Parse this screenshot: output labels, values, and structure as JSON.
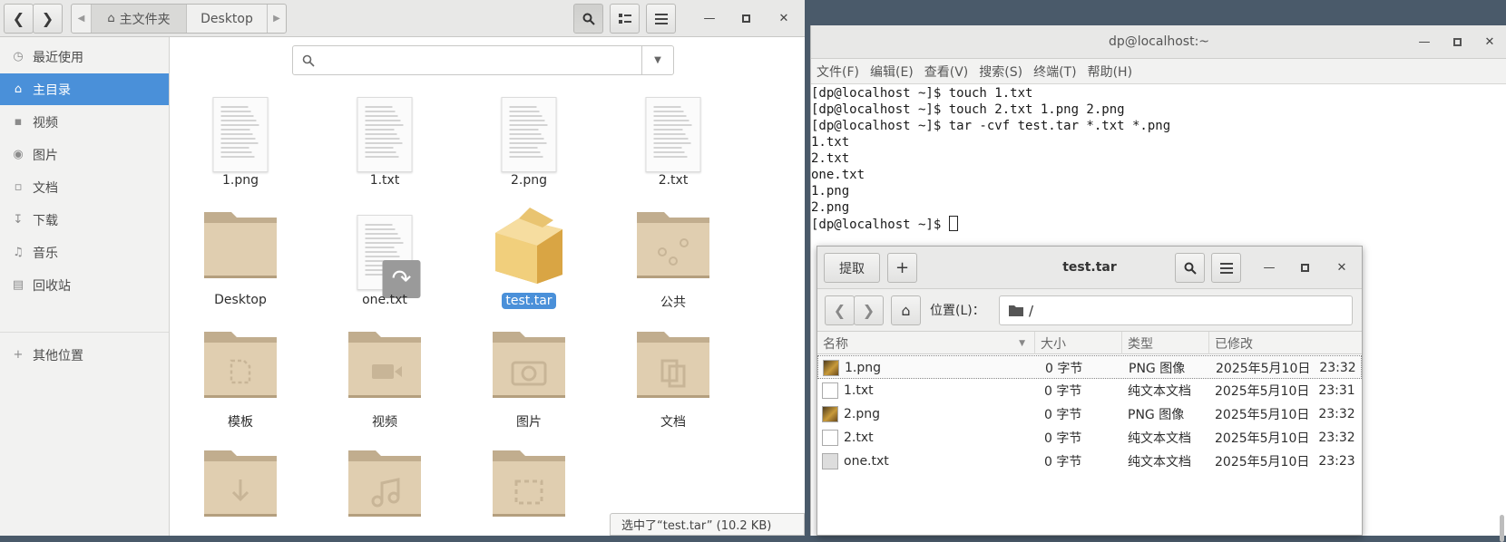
{
  "files": {
    "breadcrumb": {
      "home": "主文件夹",
      "current": "Desktop"
    },
    "sidebar": [
      {
        "label": "最近使用",
        "icon": "clock-icon"
      },
      {
        "label": "主目录",
        "icon": "home-icon",
        "active": true
      },
      {
        "label": "视频",
        "icon": "video-icon"
      },
      {
        "label": "图片",
        "icon": "camera-icon"
      },
      {
        "label": "文档",
        "icon": "document-icon"
      },
      {
        "label": "下载",
        "icon": "download-icon"
      },
      {
        "label": "音乐",
        "icon": "music-icon"
      },
      {
        "label": "回收站",
        "icon": "trash-icon"
      }
    ],
    "other_locations": "其他位置",
    "items": [
      {
        "name": "1.png",
        "type": "doc"
      },
      {
        "name": "1.txt",
        "type": "doc"
      },
      {
        "name": "2.png",
        "type": "doc"
      },
      {
        "name": "2.txt",
        "type": "doc"
      },
      {
        "name": "Desktop",
        "type": "folder"
      },
      {
        "name": "one.txt",
        "type": "link"
      },
      {
        "name": "test.tar",
        "type": "archive",
        "selected": true
      },
      {
        "name": "公共",
        "type": "folder-share"
      },
      {
        "name": "模板",
        "type": "folder-template"
      },
      {
        "name": "视频",
        "type": "folder-video"
      },
      {
        "name": "图片",
        "type": "folder-camera"
      },
      {
        "name": "文档",
        "type": "folder-docs"
      },
      {
        "name": "",
        "type": "folder-download"
      },
      {
        "name": "",
        "type": "folder-music"
      },
      {
        "name": "",
        "type": "folder-pictures"
      }
    ],
    "status": "选中了“test.tar”  (10.2 KB)"
  },
  "terminal": {
    "title": "dp@localhost:~",
    "menu": [
      "文件(F)",
      "编辑(E)",
      "查看(V)",
      "搜索(S)",
      "终端(T)",
      "帮助(H)"
    ],
    "lines": [
      "[dp@localhost ~]$ touch 1.txt",
      "[dp@localhost ~]$ touch 2.txt 1.png 2.png",
      "[dp@localhost ~]$ tar -cvf test.tar *.txt *.png",
      "1.txt",
      "2.txt",
      "one.txt",
      "1.png",
      "2.png",
      "[dp@localhost ~]$ "
    ]
  },
  "archive": {
    "title": "test.tar",
    "extract_label": "提取",
    "add_label": "+",
    "location_label": "位置(L)：",
    "location_value": "/",
    "columns": [
      "名称",
      "大小",
      "类型",
      "已修改"
    ],
    "rows": [
      {
        "name": "1.png",
        "size": "0 字节",
        "type": "PNG 图像",
        "date": "2025年5月10日",
        "time": "23:32",
        "icon": "png"
      },
      {
        "name": "1.txt",
        "size": "0 字节",
        "type": "纯文本文档",
        "date": "2025年5月10日",
        "time": "23:31",
        "icon": "txt"
      },
      {
        "name": "2.png",
        "size": "0 字节",
        "type": "PNG 图像",
        "date": "2025年5月10日",
        "time": "23:32",
        "icon": "png"
      },
      {
        "name": "2.txt",
        "size": "0 字节",
        "type": "纯文本文档",
        "date": "2025年5月10日",
        "time": "23:32",
        "icon": "txt"
      },
      {
        "name": "one.txt",
        "size": "0 字节",
        "type": "纯文本文档",
        "date": "2025年5月10日",
        "time": "23:23",
        "icon": "lnk"
      }
    ]
  }
}
